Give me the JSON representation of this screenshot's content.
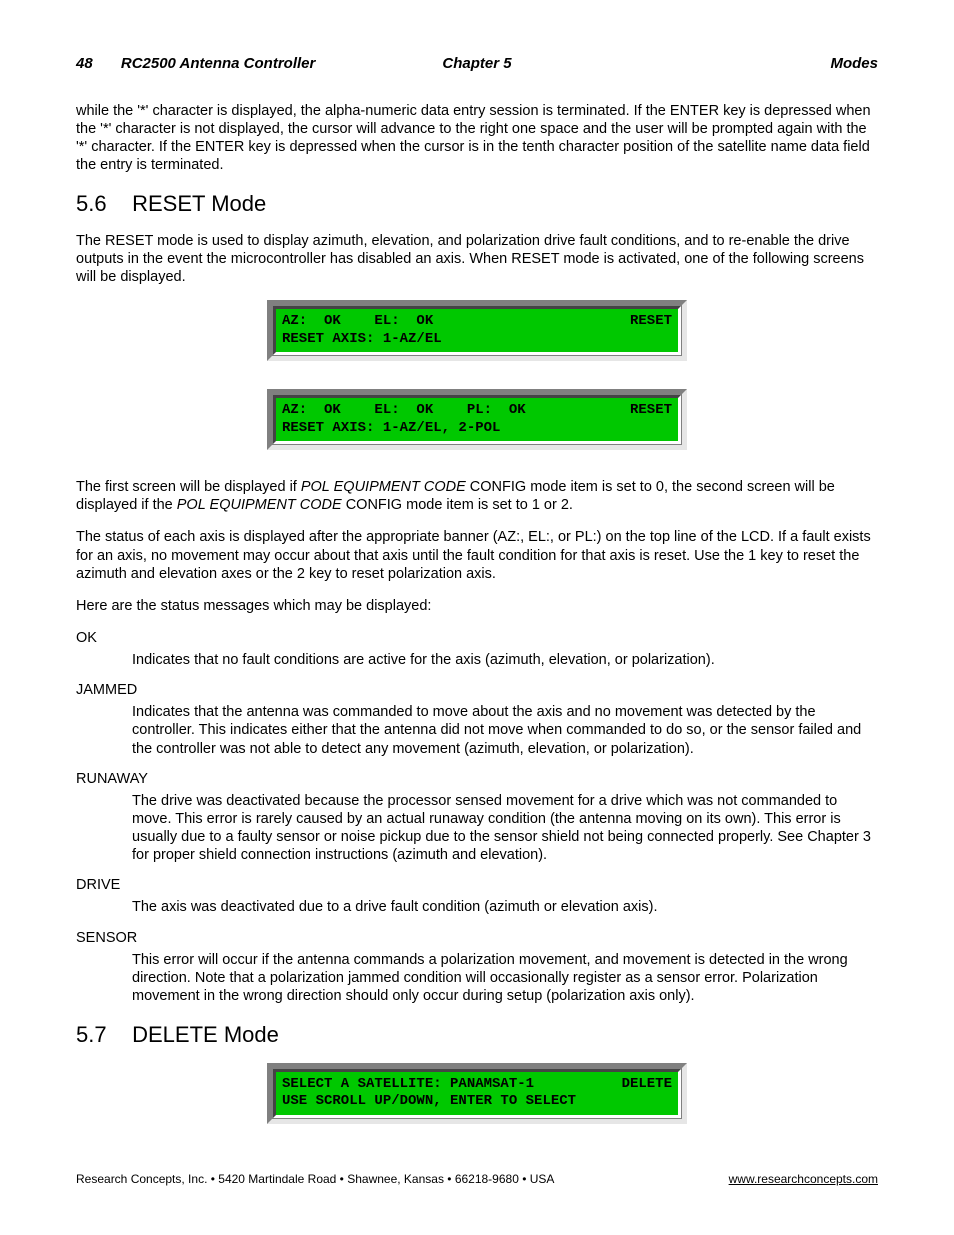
{
  "header": {
    "pageNumber": "48",
    "product": "RC2500  Antenna Controller",
    "chapter": "Chapter 5",
    "section": "Modes"
  },
  "intro_paragraph": "while the '*' character is displayed, the alpha-numeric data entry session is terminated.  If the ENTER key is depressed when the '*' character is not displayed, the cursor will advance to the right one space and the user will be prompted again with the '*' character.   If the ENTER key is depressed  when the cursor is in the tenth character position of the satellite name data field the entry is terminated.",
  "sec56": {
    "num": "5.6",
    "title": "RESET Mode",
    "p1": "The RESET mode is used to display azimuth, elevation, and polarization drive fault conditions, and to re-enable the drive outputs in the event the microcontroller has disabled an axis.  When RESET mode is activated, one of the following screens will be displayed.",
    "lcd1_line1_left": "AZ:  OK    EL:  OK",
    "lcd1_line1_right": "RESET",
    "lcd1_line2": "RESET AXIS: 1-AZ/EL",
    "lcd2_line1_left": "AZ:  OK    EL:  OK    PL:  OK",
    "lcd2_line1_right": "RESET",
    "lcd2_line2": "RESET AXIS: 1-AZ/EL, 2-POL",
    "p2_a": "The first screen will be displayed if ",
    "p2_i1": "POL EQUIPMENT CODE",
    "p2_b": " CONFIG mode item is set to 0, the second screen will be displayed if the ",
    "p2_i2": "POL EQUIPMENT CODE",
    "p2_c": " CONFIG mode item is set to 1 or 2.",
    "p3": "The status of each axis is displayed after the appropriate banner (AZ:, EL:, or PL:) on the top line of the LCD.  If a fault exists for an axis, no movement may occur about that axis until the fault condition for that axis is reset.  Use the 1 key to reset the azimuth and elevation axes or the 2 key to reset polarization axis.",
    "p4": "Here are the status messages which may be displayed:",
    "statuses": {
      "ok_term": "OK",
      "ok_def": "Indicates that no fault conditions are active for the axis (azimuth, elevation, or polarization).",
      "jammed_term": "JAMMED",
      "jammed_def": "Indicates that the antenna was commanded to move about the axis and no movement was detected by the controller.  This indicates either that the antenna did not move when commanded to do so, or the sensor failed and the controller was not able to detect any movement (azimuth, elevation, or polarization).",
      "runaway_term": "RUNAWAY",
      "runaway_def": "The drive was deactivated because the processor sensed movement for a drive which was not commanded to move.  This error is rarely caused by an actual runaway condition (the antenna moving on its own).  This error is usually due to a faulty sensor or noise pickup due to the sensor shield not being connected properly.  See Chapter 3 for proper shield connection instructions (azimuth and elevation).",
      "drive_term": "DRIVE",
      "drive_def": "The axis was deactivated due to a drive fault condition (azimuth or elevation axis).",
      "sensor_term": "SENSOR",
      "sensor_def": "This error will occur if the antenna commands a polarization movement, and movement is detected in the wrong direction.  Note that a polarization jammed condition will occasionally register as a sensor error.  Polarization movement in the wrong direction should only occur during setup (polarization axis only)."
    }
  },
  "sec57": {
    "num": "5.7",
    "title": "DELETE Mode",
    "lcd_line1_left": "SELECT A SATELLITE: PANAMSAT-1",
    "lcd_line1_right": "DELETE",
    "lcd_line2": "USE SCROLL UP/DOWN, ENTER TO SELECT"
  },
  "footer": {
    "company": "Research Concepts, Inc. • 5420 Martindale Road • Shawnee, Kansas • 66218-9680 • USA",
    "url": "www.researchconcepts.com"
  }
}
